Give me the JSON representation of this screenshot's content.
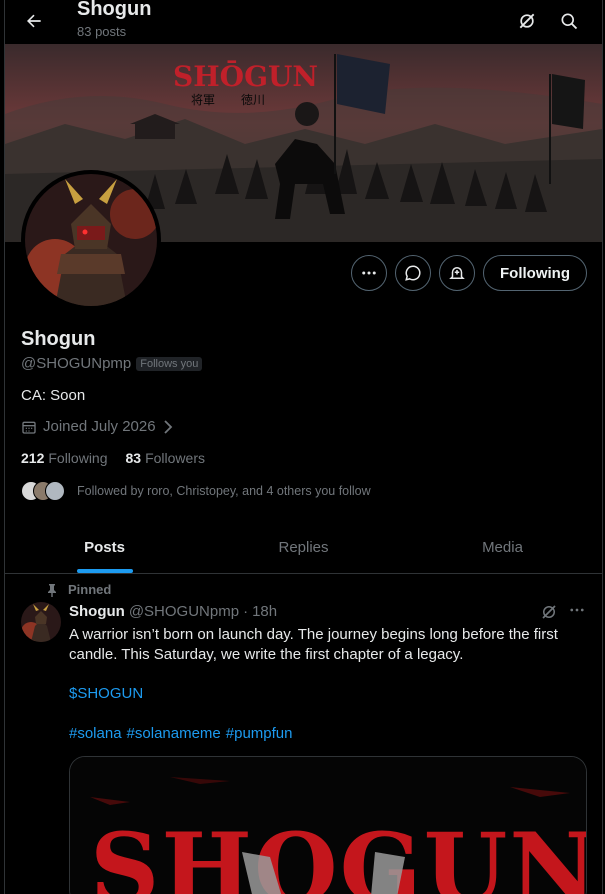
{
  "header": {
    "title": "Shogun",
    "post_count": "83 posts"
  },
  "banner": {
    "logo_text": "SHŌGUN",
    "kanji_left": "将軍",
    "kanji_right": "徳川"
  },
  "profile": {
    "name": "Shogun",
    "handle": "@SHOGUNpmp",
    "follows_you": "Follows you",
    "bio": "CA: Soon",
    "joined": "Joined July 2026",
    "following_count": "212",
    "following_label": "Following",
    "followers_count": "83",
    "followers_label": "Followers",
    "followed_by": "Followed by roro, Christopey, and 4 others you follow"
  },
  "actions": {
    "following_button": "Following"
  },
  "tabs": [
    {
      "label": "Posts",
      "active": true
    },
    {
      "label": "Replies",
      "active": false
    },
    {
      "label": "Media",
      "active": false
    }
  ],
  "post": {
    "pinned_label": "Pinned",
    "author": "Shogun",
    "handle": "@SHOGUNpmp",
    "separator": "·",
    "time": "18h",
    "text": "A warrior isn’t born on launch day. The journey begins long before the first candle. This Saturday, we write the first chapter of a legacy.",
    "cashtag": "$SHOGUN",
    "hashtags": [
      "#solana",
      "#solanameme",
      "#pumpfun"
    ],
    "media_text": "SHOGUN"
  },
  "colors": {
    "accent": "#1d9bf0",
    "muted": "#71767b",
    "text": "#e7e9ea",
    "border": "#2f3336",
    "logo_red": "#c0202a"
  }
}
